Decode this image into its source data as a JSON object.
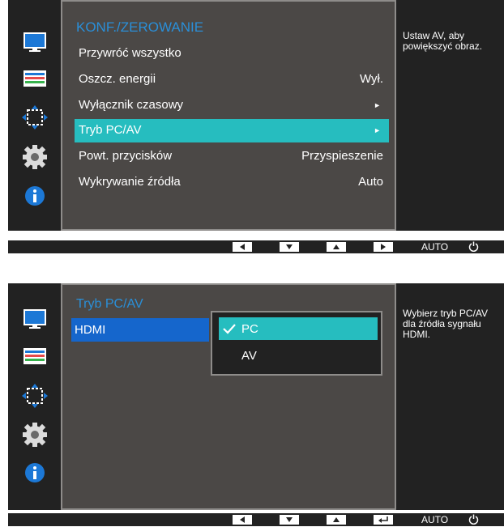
{
  "screen1": {
    "menu_title": "KONF./ZEROWANIE",
    "items": [
      {
        "label": "Przywróć wszystko",
        "value": ""
      },
      {
        "label": "Oszcz. energii",
        "value": "Wył."
      },
      {
        "label": "Wyłącznik czasowy",
        "value": "►"
      },
      {
        "label": "Tryb PC/AV",
        "value": "►"
      },
      {
        "label": "Powt. przycisków",
        "value": "Przyspieszenie"
      },
      {
        "label": "Wykrywanie źródła",
        "value": "Auto"
      }
    ],
    "selected_index": 3,
    "help_text": "Ustaw AV, aby powiększyć obraz.",
    "buttons": {
      "auto": "AUTO"
    }
  },
  "screen2": {
    "menu_title": "Tryb PC/AV",
    "left_item": "HDMI",
    "dropdown_options": [
      {
        "label": "PC",
        "checked": true
      },
      {
        "label": "AV",
        "checked": false
      }
    ],
    "help_text": "Wybierz tryb PC/AV dla źródła sygnału HDMI.",
    "buttons": {
      "auto": "AUTO"
    }
  },
  "colors": {
    "background": "#222222",
    "panel": "#4b4846",
    "highlight": "#26bdbf",
    "title_blue": "#2a8fd8",
    "hdmi_blue": "#1566cc"
  },
  "icons": [
    "picture-icon",
    "color-icon",
    "size-position-icon",
    "setup-reset-icon",
    "information-icon"
  ]
}
